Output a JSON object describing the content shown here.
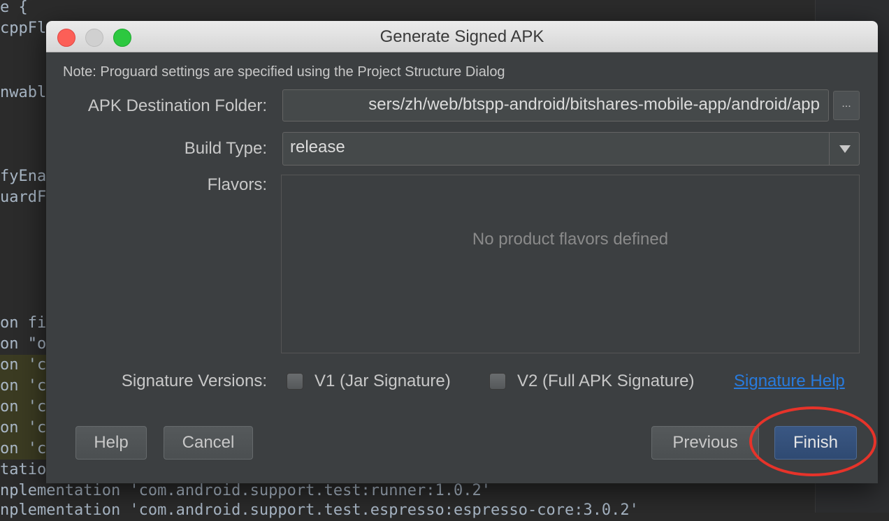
{
  "editor": {
    "lines": [
      "e {",
      "cppFla",
      "",
      "",
      "nwable",
      "",
      "",
      "",
      "fyEnab",
      "uardFi",
      "",
      "",
      "",
      "",
      "",
      "on fi",
      "on \"o",
      "on 'co",
      "on 'co",
      "on 'co",
      "on 'co",
      "on 'co",
      "tation",
      "nplementation 'com.android.support.test:runner:1.0.2'",
      "nplementation 'com.android.support.test.espresso:espresso-core:3.0.2'"
    ]
  },
  "dialog": {
    "title": "Generate Signed APK",
    "note": "Note: Proguard settings are specified using the Project Structure Dialog",
    "apk_destination_label": "APK Destination Folder:",
    "apk_destination_value": "sers/zh/web/btspp-android/bitshares-mobile-app/android/app",
    "browse_label": "...",
    "build_type_label": "Build Type:",
    "build_type_value": "release",
    "flavors_label": "Flavors:",
    "flavors_empty": "No product flavors defined",
    "signature_versions_label": "Signature Versions:",
    "v1_label": "V1 (Jar Signature)",
    "v2_label": "V2 (Full APK Signature)",
    "v1_checked": false,
    "v2_checked": false,
    "signature_help_link": "Signature Help",
    "buttons": {
      "help": "Help",
      "cancel": "Cancel",
      "previous": "Previous",
      "finish": "Finish"
    }
  },
  "colors": {
    "dialog_bg": "#3c3f41",
    "finish_button": "#2f4a72",
    "link": "#287bde",
    "annotation": "#e6332a"
  }
}
